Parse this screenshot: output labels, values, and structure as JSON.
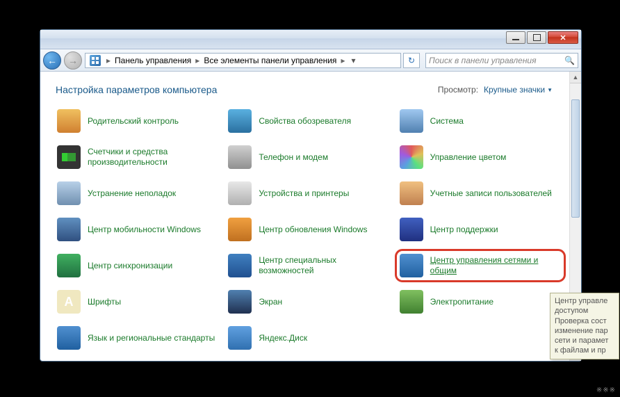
{
  "titlebar": {},
  "nav": {
    "crumb1": "Панель управления",
    "crumb2": "Все элементы панели управления",
    "search_placeholder": "Поиск в панели управления"
  },
  "header": {
    "title": "Настройка параметров компьютера",
    "view_label": "Просмотр:",
    "view_value": "Крупные значки"
  },
  "items": [
    {
      "label": "Родительский контроль",
      "icon": "ic-parental"
    },
    {
      "label": "Свойства обозревателя",
      "icon": "ic-internet"
    },
    {
      "label": "Система",
      "icon": "ic-system"
    },
    {
      "label": "Счетчики и средства производительности",
      "icon": "ic-perf"
    },
    {
      "label": "Телефон и модем",
      "icon": "ic-phone"
    },
    {
      "label": "Управление цветом",
      "icon": "ic-color"
    },
    {
      "label": "Устранение неполадок",
      "icon": "ic-trouble"
    },
    {
      "label": "Устройства и принтеры",
      "icon": "ic-devices"
    },
    {
      "label": "Учетные записи пользователей",
      "icon": "ic-users"
    },
    {
      "label": "Центр мобильности Windows",
      "icon": "ic-mobility"
    },
    {
      "label": "Центр обновления Windows",
      "icon": "ic-update"
    },
    {
      "label": "Центр поддержки",
      "icon": "ic-action"
    },
    {
      "label": "Центр синхронизации",
      "icon": "ic-sync"
    },
    {
      "label": "Центр специальных возможностей",
      "icon": "ic-ease"
    },
    {
      "label": "Центр управления сетями и общим",
      "icon": "ic-network",
      "highlight": true
    },
    {
      "label": "Шрифты",
      "icon": "ic-fonts"
    },
    {
      "label": "Экран",
      "icon": "ic-display"
    },
    {
      "label": "Электропитание",
      "icon": "ic-power"
    },
    {
      "label": "Язык и региональные стандарты",
      "icon": "ic-region"
    },
    {
      "label": "Яндекс.Диск",
      "icon": "ic-yandex"
    }
  ],
  "tooltip": {
    "line1": "Центр управле",
    "line2": "доступом",
    "line3": "Проверка сост",
    "line4": "изменение пар",
    "line5": "сети и парамет",
    "line6": "к файлам и пр"
  },
  "watermark": "※※※"
}
